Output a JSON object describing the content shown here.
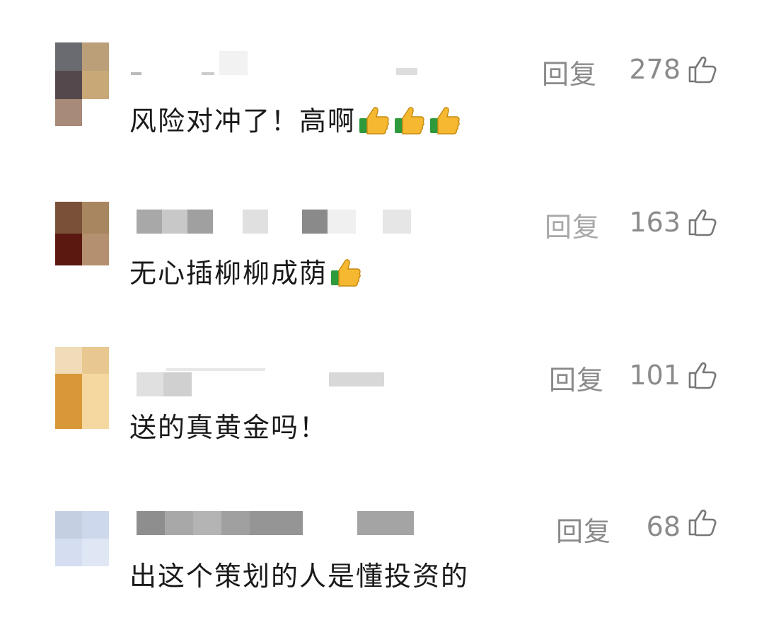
{
  "comments": [
    {
      "text": "风险对冲了！高啊",
      "reply_label": "回复",
      "likes": "278",
      "thumbs_emojis": 3,
      "like_icon": "thumbs-up-outline-icon",
      "avatar_colors": [
        "#6a6b70",
        "#bb9f78",
        "#55484c",
        "#c9a878",
        "#a88a78",
        "#e8e0d8"
      ]
    },
    {
      "text": "无心插柳柳成荫",
      "reply_label": "回复",
      "likes": "163",
      "thumbs_emojis": 1,
      "like_icon": "thumbs-up-outline-icon",
      "avatar_colors": [
        "#7a5038",
        "#a88660",
        "#5a1810",
        "#b49070"
      ]
    },
    {
      "text": "送的真黄金吗！",
      "reply_label": "回复",
      "likes": "101",
      "thumbs_emojis": 0,
      "like_icon": "thumbs-up-outline-icon",
      "avatar_colors": [
        "#f0dcb8",
        "#e8c890",
        "#d89838",
        "#f4d8a0"
      ]
    },
    {
      "text": "出这个策划的人是懂投资的",
      "reply_label": "回复",
      "likes": "68",
      "thumbs_emojis": 0,
      "like_icon": "thumbs-up-outline-icon",
      "avatar_colors": [
        "#c4d0e2",
        "#cdd8ec",
        "#d4def0",
        "#dfe6f4"
      ]
    }
  ]
}
